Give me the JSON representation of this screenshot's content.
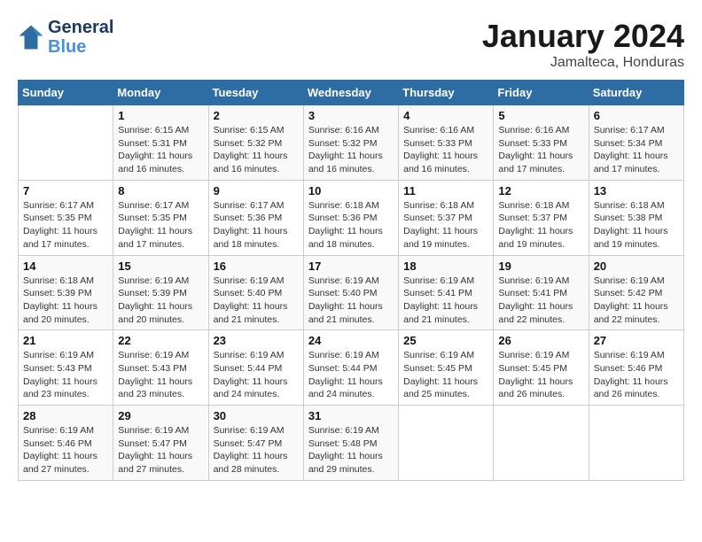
{
  "header": {
    "logo_line1": "General",
    "logo_line2": "Blue",
    "month": "January 2024",
    "location": "Jamalteca, Honduras"
  },
  "days_of_week": [
    "Sunday",
    "Monday",
    "Tuesday",
    "Wednesday",
    "Thursday",
    "Friday",
    "Saturday"
  ],
  "weeks": [
    [
      {
        "day": "",
        "info": ""
      },
      {
        "day": "1",
        "info": "Sunrise: 6:15 AM\nSunset: 5:31 PM\nDaylight: 11 hours and 16 minutes."
      },
      {
        "day": "2",
        "info": "Sunrise: 6:15 AM\nSunset: 5:32 PM\nDaylight: 11 hours and 16 minutes."
      },
      {
        "day": "3",
        "info": "Sunrise: 6:16 AM\nSunset: 5:32 PM\nDaylight: 11 hours and 16 minutes."
      },
      {
        "day": "4",
        "info": "Sunrise: 6:16 AM\nSunset: 5:33 PM\nDaylight: 11 hours and 16 minutes."
      },
      {
        "day": "5",
        "info": "Sunrise: 6:16 AM\nSunset: 5:33 PM\nDaylight: 11 hours and 17 minutes."
      },
      {
        "day": "6",
        "info": "Sunrise: 6:17 AM\nSunset: 5:34 PM\nDaylight: 11 hours and 17 minutes."
      }
    ],
    [
      {
        "day": "7",
        "info": "Sunrise: 6:17 AM\nSunset: 5:35 PM\nDaylight: 11 hours and 17 minutes."
      },
      {
        "day": "8",
        "info": "Sunrise: 6:17 AM\nSunset: 5:35 PM\nDaylight: 11 hours and 17 minutes."
      },
      {
        "day": "9",
        "info": "Sunrise: 6:17 AM\nSunset: 5:36 PM\nDaylight: 11 hours and 18 minutes."
      },
      {
        "day": "10",
        "info": "Sunrise: 6:18 AM\nSunset: 5:36 PM\nDaylight: 11 hours and 18 minutes."
      },
      {
        "day": "11",
        "info": "Sunrise: 6:18 AM\nSunset: 5:37 PM\nDaylight: 11 hours and 19 minutes."
      },
      {
        "day": "12",
        "info": "Sunrise: 6:18 AM\nSunset: 5:37 PM\nDaylight: 11 hours and 19 minutes."
      },
      {
        "day": "13",
        "info": "Sunrise: 6:18 AM\nSunset: 5:38 PM\nDaylight: 11 hours and 19 minutes."
      }
    ],
    [
      {
        "day": "14",
        "info": "Sunrise: 6:18 AM\nSunset: 5:39 PM\nDaylight: 11 hours and 20 minutes."
      },
      {
        "day": "15",
        "info": "Sunrise: 6:19 AM\nSunset: 5:39 PM\nDaylight: 11 hours and 20 minutes."
      },
      {
        "day": "16",
        "info": "Sunrise: 6:19 AM\nSunset: 5:40 PM\nDaylight: 11 hours and 21 minutes."
      },
      {
        "day": "17",
        "info": "Sunrise: 6:19 AM\nSunset: 5:40 PM\nDaylight: 11 hours and 21 minutes."
      },
      {
        "day": "18",
        "info": "Sunrise: 6:19 AM\nSunset: 5:41 PM\nDaylight: 11 hours and 21 minutes."
      },
      {
        "day": "19",
        "info": "Sunrise: 6:19 AM\nSunset: 5:41 PM\nDaylight: 11 hours and 22 minutes."
      },
      {
        "day": "20",
        "info": "Sunrise: 6:19 AM\nSunset: 5:42 PM\nDaylight: 11 hours and 22 minutes."
      }
    ],
    [
      {
        "day": "21",
        "info": "Sunrise: 6:19 AM\nSunset: 5:43 PM\nDaylight: 11 hours and 23 minutes."
      },
      {
        "day": "22",
        "info": "Sunrise: 6:19 AM\nSunset: 5:43 PM\nDaylight: 11 hours and 23 minutes."
      },
      {
        "day": "23",
        "info": "Sunrise: 6:19 AM\nSunset: 5:44 PM\nDaylight: 11 hours and 24 minutes."
      },
      {
        "day": "24",
        "info": "Sunrise: 6:19 AM\nSunset: 5:44 PM\nDaylight: 11 hours and 24 minutes."
      },
      {
        "day": "25",
        "info": "Sunrise: 6:19 AM\nSunset: 5:45 PM\nDaylight: 11 hours and 25 minutes."
      },
      {
        "day": "26",
        "info": "Sunrise: 6:19 AM\nSunset: 5:45 PM\nDaylight: 11 hours and 26 minutes."
      },
      {
        "day": "27",
        "info": "Sunrise: 6:19 AM\nSunset: 5:46 PM\nDaylight: 11 hours and 26 minutes."
      }
    ],
    [
      {
        "day": "28",
        "info": "Sunrise: 6:19 AM\nSunset: 5:46 PM\nDaylight: 11 hours and 27 minutes."
      },
      {
        "day": "29",
        "info": "Sunrise: 6:19 AM\nSunset: 5:47 PM\nDaylight: 11 hours and 27 minutes."
      },
      {
        "day": "30",
        "info": "Sunrise: 6:19 AM\nSunset: 5:47 PM\nDaylight: 11 hours and 28 minutes."
      },
      {
        "day": "31",
        "info": "Sunrise: 6:19 AM\nSunset: 5:48 PM\nDaylight: 11 hours and 29 minutes."
      },
      {
        "day": "",
        "info": ""
      },
      {
        "day": "",
        "info": ""
      },
      {
        "day": "",
        "info": ""
      }
    ]
  ]
}
